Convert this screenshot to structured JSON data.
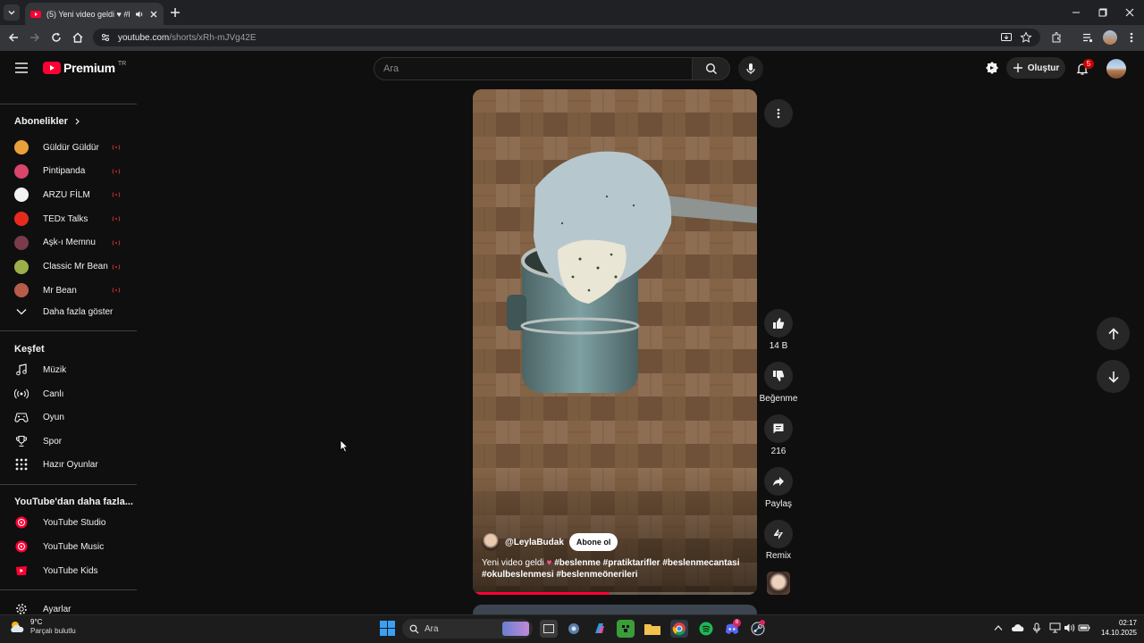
{
  "browser": {
    "tab_title": "(5) Yeni video geldi ♥ #besl",
    "url_host": "youtube.com",
    "url_path": "/shorts/xRh-mJVg42E"
  },
  "header": {
    "logo_text": "Premium",
    "logo_region": "TR",
    "search_placeholder": "Ara",
    "create_label": "Oluştur",
    "notification_count": "5"
  },
  "sidebar": {
    "subscriptions_title": "Abonelikler",
    "subscriptions": [
      {
        "name": "Güldür Güldür",
        "color": "#e8a13a"
      },
      {
        "name": "Pintipanda",
        "color": "#d9456b"
      },
      {
        "name": "ARZU FİLM",
        "color": "#f2f2f2"
      },
      {
        "name": "TEDx Talks",
        "color": "#e62b1e"
      },
      {
        "name": "Aşk-ı Memnu",
        "color": "#7a3b4a"
      },
      {
        "name": "Classic Mr Bean",
        "color": "#9bb04a"
      },
      {
        "name": "Mr Bean",
        "color": "#b85c4a"
      }
    ],
    "show_more": "Daha fazla göster",
    "explore_title": "Keşfet",
    "explore": [
      {
        "name": "Müzik",
        "icon": "music-note-icon"
      },
      {
        "name": "Canlı",
        "icon": "live-icon"
      },
      {
        "name": "Oyun",
        "icon": "gamepad-icon"
      },
      {
        "name": "Spor",
        "icon": "trophy-icon"
      },
      {
        "name": "Hazır Oyunlar",
        "icon": "playables-icon"
      }
    ],
    "more_title": "YouTube'dan daha fazla...",
    "more": [
      {
        "name": "YouTube Studio"
      },
      {
        "name": "YouTube Music"
      },
      {
        "name": "YouTube Kids"
      }
    ],
    "settings": "Ayarlar"
  },
  "short": {
    "channel": "@LeylaBudak",
    "subscribe_label": "Abone ol",
    "caption_line1_prefix": "Yeni video geldi",
    "caption_line1_tags": "#beslenme #pratiktarifler #beslenmecantasi",
    "caption_line2": "#okulbeslenmesi #beslenmeönerileri",
    "progress_fraction": 0.48,
    "likes": "14 B",
    "dislike_label": "Beğenme",
    "comments": "216",
    "share_label": "Paylaş",
    "remix_label": "Remix"
  },
  "taskbar": {
    "weather_temp": "9°C",
    "weather_desc": "Parçalı bulutlu",
    "search_label": "Ara",
    "time": "02:17",
    "date": "14.10.2025",
    "discord_badge": "8"
  },
  "colors": {
    "youtube_red": "#ff0033",
    "background": "#0f0f0f"
  }
}
